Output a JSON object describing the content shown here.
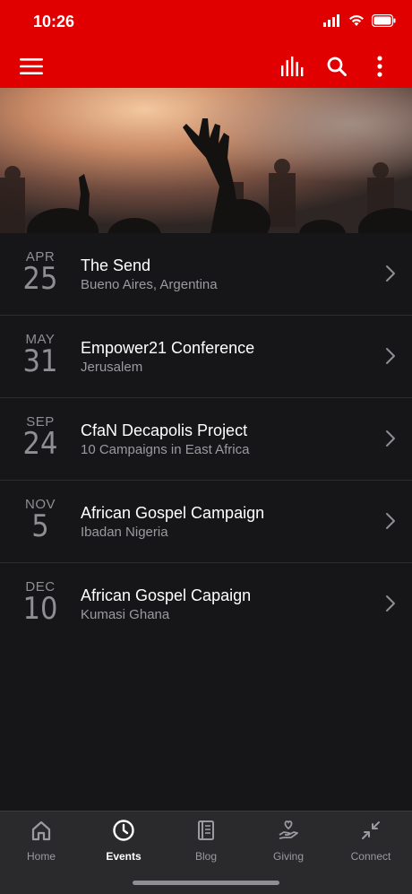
{
  "status": {
    "time": "10:26"
  },
  "events": [
    {
      "month": "APR",
      "day": "25",
      "title": "The Send",
      "location": "Bueno Aires, Argentina"
    },
    {
      "month": "MAY",
      "day": "31",
      "title": "Empower21 Conference",
      "location": "Jerusalem"
    },
    {
      "month": "SEP",
      "day": "24",
      "title": "CfaN Decapolis Project",
      "location": "10 Campaigns in East Africa"
    },
    {
      "month": "NOV",
      "day": "5",
      "title": "African Gospel Campaign",
      "location": "Ibadan Nigeria"
    },
    {
      "month": "DEC",
      "day": "10",
      "title": "African Gospel Capaign",
      "location": "Kumasi Ghana"
    }
  ],
  "tabs": [
    {
      "label": "Home",
      "icon": "home-icon"
    },
    {
      "label": "Events",
      "icon": "clock-icon",
      "active": true
    },
    {
      "label": "Blog",
      "icon": "book-icon"
    },
    {
      "label": "Giving",
      "icon": "giving-hand-icon"
    },
    {
      "label": "Connect",
      "icon": "collapse-arrows-icon"
    }
  ],
  "colors": {
    "header": "#e00000",
    "background": "#161618",
    "tabbar": "#2a2a2c"
  }
}
